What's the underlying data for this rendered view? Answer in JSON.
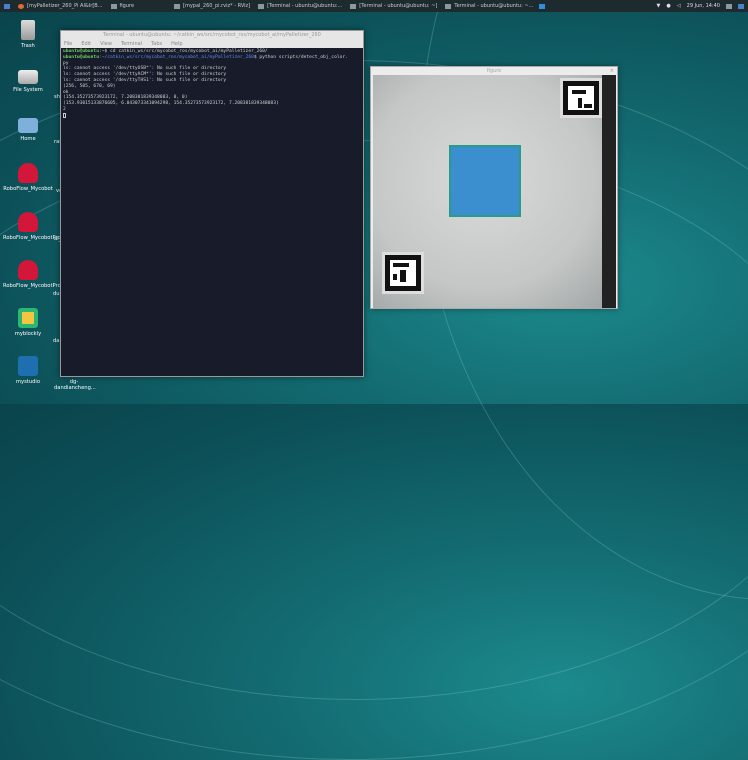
{
  "taskbar": {
    "tasks": [
      "[myPalletizer_260_Pi AI&Ir[B...",
      "figure",
      "[mypal_260_pi.rviz* - RViz]",
      "[Terminal - ubuntu@ubuntu:...",
      "[Terminal - ubuntu@ubuntu: ~]",
      "Terminal - ubuntu@ubuntu: ~..."
    ],
    "clock": "29 Jun, 14:40"
  },
  "desktop": {
    "icons": [
      "Trash",
      "File System",
      "Home",
      "RoboFlow_Mycobot",
      "RoboFlow_MycobotPro",
      "RoboFlow_MycobotPro320",
      "myblockly",
      "mystudio"
    ],
    "hidden_labels": [
      "shr",
      "ras",
      "ve",
      "ai_",
      "duc",
      "dan",
      "dg-dandiancheng..."
    ]
  },
  "terminal": {
    "title": "Terminal - ubuntu@ubuntu: ~/catkin_ws/src/mycobot_ros/mycobot_ai/myPalletizer_260",
    "menu": [
      "File",
      "Edit",
      "View",
      "Terminal",
      "Tabs",
      "Help"
    ],
    "prompt_user": "ubuntu@ubuntu",
    "cmd1": ":~$ cd catkin_ws/src/mycobot_ros/mycobot_ai/myPalletizer_260/",
    "path2": ":~/catkin_ws/src/mycobot_ros/mycobot_ai/myPalletizer_260",
    "cmd2": "$ python scripts/detect_obj_color.",
    "output": [
      "py",
      "ls: cannot access '/dev/ttyUSB*': No such file or directory",
      "ls: cannot access '/dev/ttyACM*': No such file or directory",
      "ls: cannot access '/dev/ttyTHS1': No such file or directory",
      "(256, 505, 670, 69)",
      "ok",
      "(154.35273573923172, 7.208381839348083, 0, 0)",
      "(153.93015133876605, 6.043073341094298, 154.35273573923172, 7.208381839348083)",
      "2"
    ]
  },
  "figure": {
    "title": "figure"
  }
}
